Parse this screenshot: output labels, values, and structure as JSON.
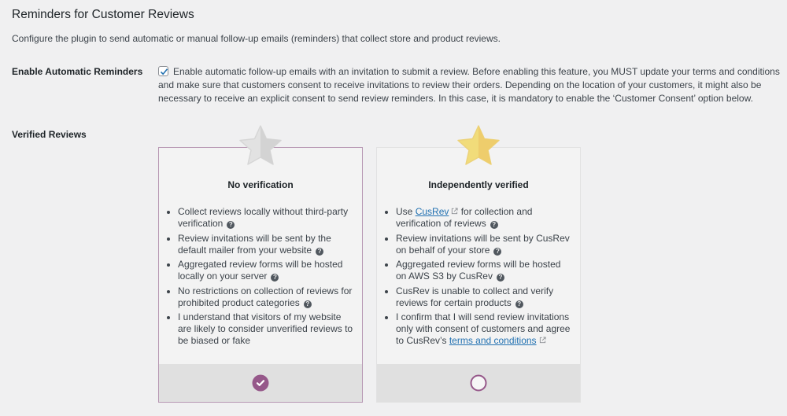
{
  "header": {
    "title": "Reminders for Customer Reviews",
    "description": "Configure the plugin to send automatic or manual follow-up emails (reminders) that collect store and product reviews."
  },
  "auto_reminders": {
    "label": "Enable Automatic Reminders",
    "checked": true,
    "text": "Enable automatic follow-up emails with an invitation to submit a review. Before enabling this feature, you MUST update your terms and conditions and make sure that customers consent to receive invitations to review their orders. Depending on the location of your customers, it might also be necessary to receive an explicit consent to send review reminders. In this case, it is mandatory to enable the ‘Customer Consent’ option below."
  },
  "verified_reviews": {
    "label": "Verified Reviews",
    "accent_color": "#96588a",
    "options": [
      {
        "title": "No verification",
        "selected": true,
        "star": "grey-star",
        "items": [
          {
            "text": "Collect reviews locally without third-party verification",
            "help": true
          },
          {
            "text": "Review invitations will be sent by the default mailer from your website",
            "help": true
          },
          {
            "text": "Aggregated review forms will be hosted locally on your server",
            "help": true
          },
          {
            "text": "No restrictions on collection of reviews for prohibited product categories",
            "help": true
          },
          {
            "text": "I understand that visitors of my website are likely to consider unverified reviews to be biased or fake",
            "help": false
          }
        ]
      },
      {
        "title": "Independently verified",
        "selected": false,
        "star": "gold-star",
        "items": [
          {
            "prefix": "Use ",
            "link": "CusRev",
            "suffix": " for collection and verification of reviews",
            "help": true
          },
          {
            "text": "Review invitations will be sent by CusRev on behalf of your store",
            "help": true
          },
          {
            "text": "Aggregated review forms will be hosted on AWS S3 by CusRev",
            "help": true
          },
          {
            "text": "CusRev is unable to collect and verify reviews for certain products",
            "help": true
          },
          {
            "prefix": "I confirm that I will send review invitations only with consent of customers and agree to CusRev’s ",
            "link": "terms and conditions",
            "help": false
          }
        ]
      }
    ]
  }
}
